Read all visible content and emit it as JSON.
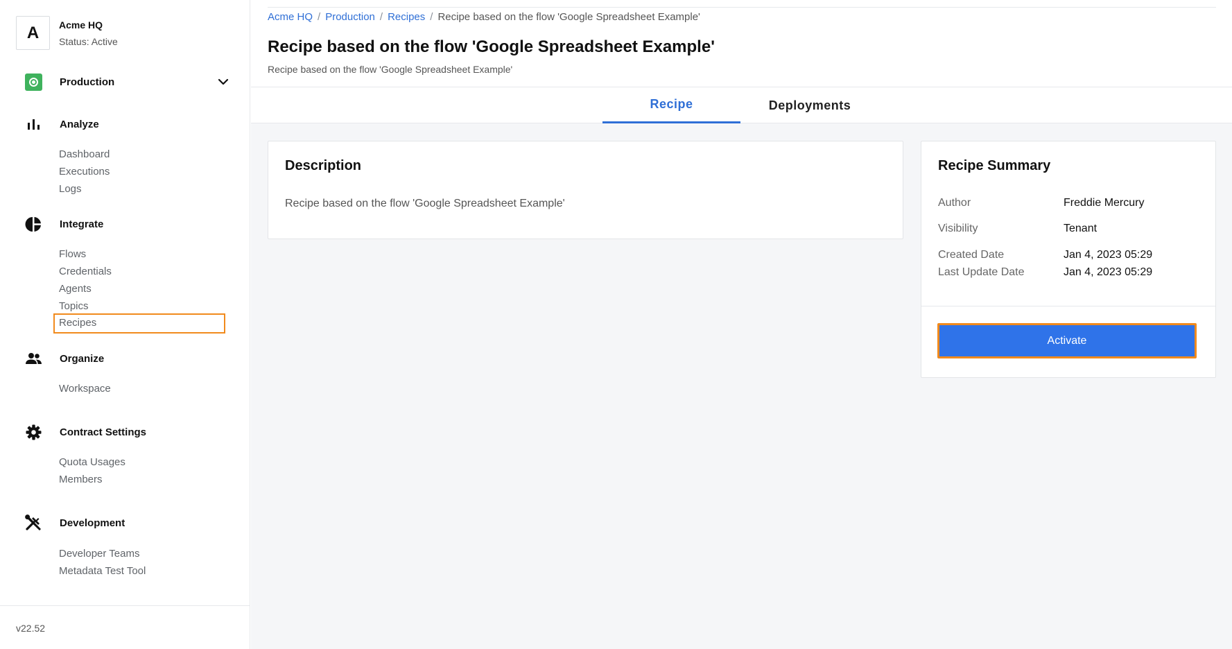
{
  "tenant": {
    "initial": "A",
    "name": "Acme HQ",
    "status": "Status: Active"
  },
  "environment": {
    "label": "Production",
    "icon": "environment-target-icon"
  },
  "sidebar": {
    "analyze": {
      "label": "Analyze",
      "items": [
        "Dashboard",
        "Executions",
        "Logs"
      ]
    },
    "integrate": {
      "label": "Integrate",
      "items": [
        "Flows",
        "Credentials",
        "Agents",
        "Topics",
        "Recipes"
      ]
    },
    "organize": {
      "label": "Organize",
      "items": [
        "Workspace"
      ]
    },
    "contract": {
      "label": "Contract Settings",
      "items": [
        "Quota Usages",
        "Members"
      ]
    },
    "development": {
      "label": "Development",
      "items": [
        "Developer Teams",
        "Metadata Test Tool"
      ]
    },
    "version": "v22.52",
    "active_item": "Recipes"
  },
  "breadcrumb": {
    "items": [
      "Acme HQ",
      "Production",
      "Recipes"
    ],
    "current": "Recipe based on the flow 'Google Spreadsheet Example'",
    "separator": "/"
  },
  "page": {
    "title": "Recipe based on the flow 'Google Spreadsheet Example'",
    "subtitle": "Recipe based on the flow 'Google Spreadsheet Example'"
  },
  "tabs": [
    {
      "label": "Recipe",
      "active": true
    },
    {
      "label": "Deployments",
      "active": false
    }
  ],
  "description_card": {
    "title": "Description",
    "text": "Recipe based on the flow 'Google Spreadsheet Example'"
  },
  "summary_card": {
    "title": "Recipe Summary",
    "rows": [
      {
        "key": "Author",
        "value": "Freddie Mercury"
      },
      {
        "key": "Visibility",
        "value": "Tenant"
      },
      {
        "key": "Created Date",
        "value": "Jan 4, 2023 05:29"
      },
      {
        "key": "Last Update Date",
        "value": "Jan 4, 2023 05:29"
      }
    ],
    "action_label": "Activate"
  },
  "colors": {
    "accent": "#2f6fd6",
    "button": "#2f73e9",
    "highlight": "#f18a1c",
    "environment": "#3fb25d"
  }
}
